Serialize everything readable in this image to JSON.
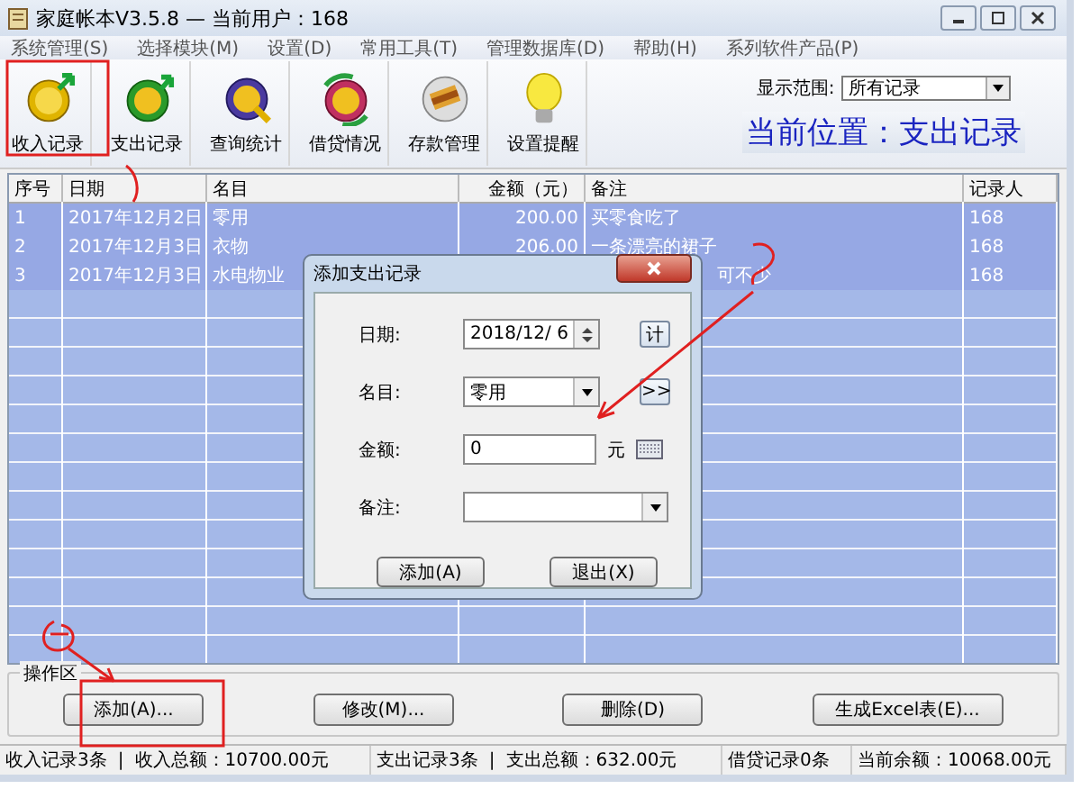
{
  "window": {
    "title": "家庭帐本V3.5.8 — 当前用户：168"
  },
  "menu": [
    "系统管理(S)",
    "选择模块(M)",
    "设置(D)",
    "常用工具(T)",
    "管理数据库(D)",
    "帮助(H)",
    "系列软件产品(P)"
  ],
  "toolbar": {
    "buttons": [
      {
        "label": "收入记录",
        "kind": "income"
      },
      {
        "label": "支出记录",
        "kind": "expense"
      },
      {
        "label": "查询统计",
        "kind": "query"
      },
      {
        "label": "借贷情况",
        "kind": "loan"
      },
      {
        "label": "存款管理",
        "kind": "deposit"
      },
      {
        "label": "设置提醒",
        "kind": "reminder"
      }
    ],
    "range": {
      "label": "显示范围:",
      "value": "所有记录"
    },
    "location": "当前位置：支出记录"
  },
  "table": {
    "columns": [
      "序号",
      "日期",
      "名目",
      "金额（元）",
      "备注",
      "记录人"
    ],
    "rows": [
      {
        "no": "1",
        "date": "2017年12月2日",
        "item": "零用",
        "amount": "200.00",
        "note": "买零食吃了",
        "recorder": "168",
        "selected": true
      },
      {
        "no": "2",
        "date": "2017年12月3日",
        "item": "衣物",
        "amount": "206.00",
        "note": "一条漂亮的裙子",
        "recorder": "168",
        "selected": true
      },
      {
        "no": "3",
        "date": "2017年12月3日",
        "item": "水电物业",
        "note": "可不少",
        "recorder": "168",
        "selected": true
      }
    ]
  },
  "dialog": {
    "title": "添加支出记录",
    "date_label": "日期:",
    "date_value": "2018/12/ 6",
    "calc_button": "计",
    "item_label": "名目:",
    "item_value": "零用",
    "more_button": ">>",
    "amount_label": "金额:",
    "amount_value": "0",
    "unit": "元",
    "note_label": "备注:",
    "buttons": [
      "添加(A)",
      "退出(X)"
    ]
  },
  "operations": {
    "title": "操作区",
    "buttons": [
      "添加(A)...",
      "修改(M)...",
      "删除(D)",
      "生成Excel表(E)..."
    ]
  },
  "status_bar": [
    [
      "收入记录3条",
      "|",
      "收入总额：10700.00元"
    ],
    [
      "支出记录3条",
      "|",
      "支出总额：632.00元"
    ],
    [
      "借贷记录0条"
    ],
    [
      "当前余额：10068.00元"
    ]
  ]
}
